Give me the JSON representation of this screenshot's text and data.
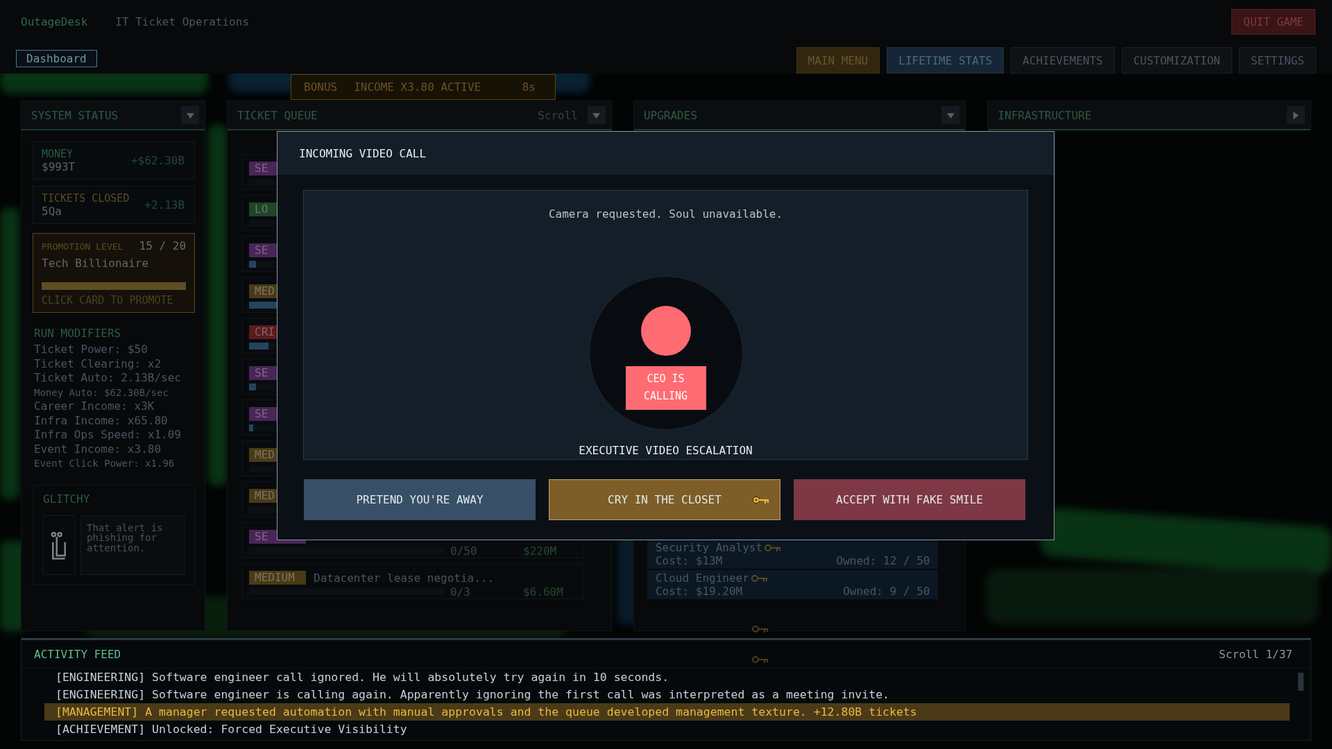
{
  "app": {
    "brand": "OutageDesk",
    "subtitle": "IT Ticket Operations",
    "quit": "QUIT GAME"
  },
  "nav": {
    "tabs": [
      {
        "label": "Dashboard",
        "selected": true
      }
    ],
    "menu": [
      {
        "label": "MAIN MENU",
        "kind": "gold"
      },
      {
        "label": "LIFETIME STATS",
        "kind": "blue"
      },
      {
        "label": "ACHIEVEMENTS",
        "kind": "plain"
      },
      {
        "label": "CUSTOMIZATION",
        "kind": "plain"
      },
      {
        "label": "SETTINGS",
        "kind": "plain"
      }
    ]
  },
  "bonus": {
    "tag": "BONUS",
    "text": "INCOME X3.80 ACTIVE",
    "timer": "8s"
  },
  "system_status": {
    "title": "SYSTEM STATUS",
    "expanded": true,
    "stats": [
      {
        "label": "MONEY",
        "value": "$993T",
        "delta": "+$62.30B",
        "kind": "money"
      },
      {
        "label": "TICKETS CLOSED",
        "value": "5Qa",
        "delta": "+2.13B",
        "kind": "tickets"
      }
    ],
    "promotion": {
      "label": "PROMOTION LEVEL",
      "progress": "15 / 20",
      "rank": "Tech Billionaire",
      "level": 1,
      "hint": "CLICK CARD TO PROMOTE"
    },
    "modifiers_title": "RUN MODIFIERS",
    "modifiers": [
      {
        "text": "Ticket Power: $50",
        "kind": "main"
      },
      {
        "text": "Ticket Clearing: x2",
        "kind": "main"
      },
      {
        "text": "Ticket Auto: 2.13B/sec",
        "kind": "main"
      },
      {
        "text": "Money Auto: $62.30B/sec",
        "kind": "minor"
      },
      {
        "text": "Career Income: x3K",
        "kind": "main"
      },
      {
        "text": "Infra Income: x65.80",
        "kind": "main"
      },
      {
        "text": "Infra Ops Speed: x1.09",
        "kind": "main"
      },
      {
        "text": "Event Income: x3.80",
        "kind": "main"
      },
      {
        "text": "Event Click Power: x1.96",
        "kind": "minor"
      }
    ],
    "assistant": {
      "name": "GLITCHY",
      "message": "That alert is phishing for attention."
    }
  },
  "ticket_queue": {
    "title": "TICKET QUEUE",
    "scroll": "Scroll",
    "expanded": true,
    "tickets": [
      {
        "badge": "SE",
        "color": "#4a2558"
      },
      {
        "badge": "LO",
        "color": "#1f4429"
      },
      {
        "badge": "SE",
        "color": "#4a2558",
        "level": 0.035
      },
      {
        "badge": "MED",
        "color": "#4a3a16",
        "level": 0.2
      },
      {
        "badge": "CRI",
        "color": "#5a1c1e",
        "level": 0.1
      },
      {
        "badge": "SE",
        "color": "#4a2558",
        "level": 0.035
      },
      {
        "badge": "SE",
        "color": "#4a2558",
        "level": 0.02
      },
      {
        "badge": "MED",
        "color": "#4a3a16"
      },
      {
        "badge": "MED",
        "color": "#4a3a16"
      },
      {
        "badge": "SE",
        "color": "#4a2558",
        "progress": "0/50",
        "reward": "$220M"
      },
      {
        "badge": "MEDIUM",
        "color": "#4a3a16",
        "title": "Datacenter lease negotia...",
        "progress": "0/3",
        "reward": "$6.60M"
      }
    ]
  },
  "upgrades": {
    "title": "UPGRADES",
    "expanded": true,
    "items": [
      {
        "name": "Security Analyst",
        "cost": "Cost: $13M",
        "owned": "Owned: 12 / 50"
      },
      {
        "name": "Cloud Engineer",
        "cost": "Cost: $19.20M",
        "owned": "Owned: 9 / 50"
      }
    ]
  },
  "infrastructure": {
    "title": "INFRASTRUCTURE",
    "expanded": false
  },
  "activity_feed": {
    "title": "ACTIVITY FEED",
    "scroll": "Scroll 1/37",
    "entries": [
      {
        "text": "[ENGINEERING] Software engineer call ignored. He will absolutely try again in 10 seconds.",
        "highlighted": false
      },
      {
        "text": "[ENGINEERING] Software engineer is calling again. Apparently ignoring the first call was interpreted as a meeting invite.",
        "highlighted": false
      },
      {
        "text": "[MANAGEMENT] A manager requested automation with manual approvals and the queue developed management texture. +12.80B tickets",
        "highlighted": true
      },
      {
        "text": "[ACHIEVEMENT] Unlocked: Forced Executive Visibility",
        "highlighted": false
      }
    ]
  },
  "dialog": {
    "title": "INCOMING VIDEO CALL",
    "message": "Camera requested. Soul unavailable.",
    "caller": "CEO IS CALLING",
    "caption": "EXECUTIVE VIDEO ESCALATION",
    "actions": [
      {
        "label": "PRETEND YOU'RE AWAY",
        "kind": "neutral",
        "key": false
      },
      {
        "label": "CRY IN THE CLOSET",
        "kind": "warning",
        "key": true
      },
      {
        "label": "ACCEPT WITH FAKE SMILE",
        "kind": "danger",
        "key": false
      }
    ]
  }
}
